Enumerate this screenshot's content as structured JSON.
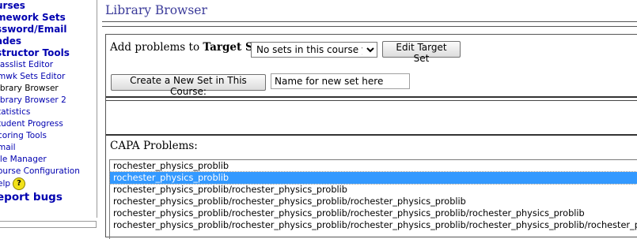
{
  "sidebar": {
    "main_items": [
      {
        "label": "urses"
      },
      {
        "label": "mework Sets"
      },
      {
        "label": "ssword/Email"
      },
      {
        "label": "ades"
      },
      {
        "label": "structor Tools"
      }
    ],
    "sub_items": [
      {
        "label": "lasslist Editor"
      },
      {
        "label": "mwk Sets Editor"
      },
      {
        "label": "ibrary Browser"
      },
      {
        "label": "ibrary Browser 2"
      },
      {
        "label": "tatistics"
      },
      {
        "label": "tudent Progress"
      },
      {
        "label": "coring Tools"
      },
      {
        "label": "mail"
      },
      {
        "label": "ile Manager"
      },
      {
        "label": "ourse Configuration"
      },
      {
        "label": "elp"
      }
    ],
    "help_icon": "question-icon",
    "report_bugs": "eport bugs"
  },
  "main": {
    "title": "Library Browser",
    "add_prefix": "Add problems to ",
    "target_set_label": "Target Set:",
    "target_set_selected": "No sets in this course yet",
    "edit_target_set_button": "Edit Target Set",
    "create_set_button": "Create a New Set in This Course:",
    "new_set_name_value": "Name for new set here",
    "capa_label": "CAPA Problems:",
    "capa_options": [
      "rochester_physics_problib",
      "rochester_physics_problib",
      "rochester_physics_problib/rochester_physics_problib",
      "rochester_physics_problib/rochester_physics_problib/rochester_physics_problib",
      "rochester_physics_problib/rochester_physics_problib/rochester_physics_problib/rochester_physics_problib",
      "rochester_physics_problib/rochester_physics_problib/rochester_physics_problib/rochester_physics_problib/rochester_phys"
    ],
    "capa_selected_index": 1
  },
  "colors": {
    "link": "#0000b0",
    "title": "#3b3b9a",
    "selection": "#3399ff"
  }
}
